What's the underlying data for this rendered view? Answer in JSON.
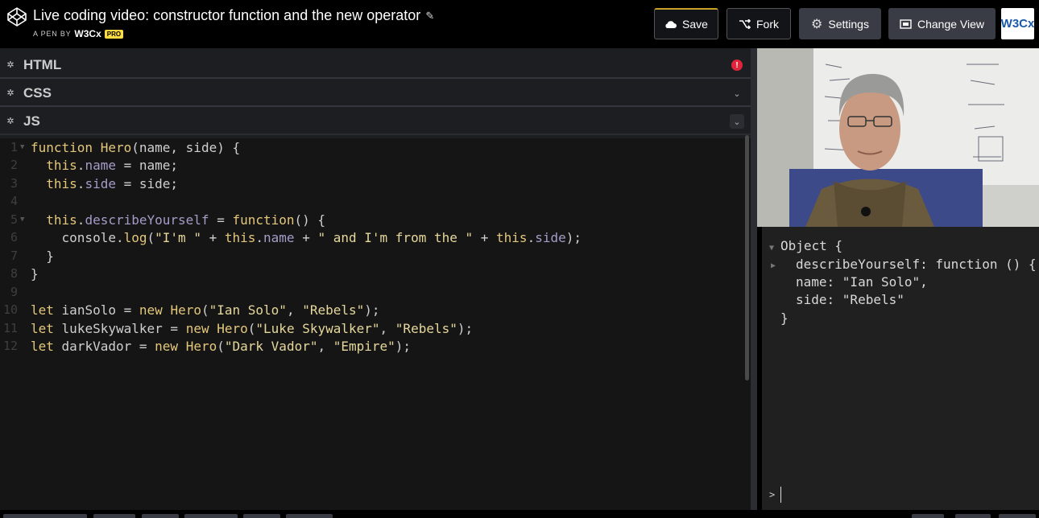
{
  "header": {
    "title": "Live coding video: constructor function and the new operator",
    "byline_prefix": "A PEN BY",
    "author": "W3Cx",
    "badge": "PRO",
    "buttons": {
      "save": "Save",
      "fork": "Fork",
      "settings": "Settings",
      "change_view": "Change View"
    },
    "avatar_text": "W3Cx"
  },
  "panels": {
    "html": "HTML",
    "css": "CSS",
    "js": "JS"
  },
  "code_lines": [
    {
      "n": "1",
      "t": "function Hero(name, side) {"
    },
    {
      "n": "2",
      "t": "  this.name = name;"
    },
    {
      "n": "3",
      "t": "  this.side = side;"
    },
    {
      "n": "4",
      "t": ""
    },
    {
      "n": "5",
      "t": "  this.describeYourself = function() {"
    },
    {
      "n": "6",
      "t": "    console.log(\"I'm \" + this.name + \" and I'm from the \" + this.side);"
    },
    {
      "n": "7",
      "t": "  }"
    },
    {
      "n": "8",
      "t": "}"
    },
    {
      "n": "9",
      "t": ""
    },
    {
      "n": "10",
      "t": "let ianSolo = new Hero(\"Ian Solo\", \"Rebels\");"
    },
    {
      "n": "11",
      "t": "let lukeSkywalker = new Hero(\"Luke Skywalker\", \"Rebels\");"
    },
    {
      "n": "12",
      "t": "let darkVador = new Hero(\"Dark Vador\", \"Empire\");"
    }
  ],
  "console_lines": [
    "Object {",
    "describeYourself: function () {",
    "name: \"Ian Solo\",",
    "side: \"Rebels\"",
    "}"
  ],
  "colors": {
    "editor_bg": "#151515",
    "keyword": "#e3c77b",
    "string": "#e6d89c",
    "property": "#a69cc8",
    "error": "#e0243c",
    "pro_badge": "#ffdd40"
  }
}
